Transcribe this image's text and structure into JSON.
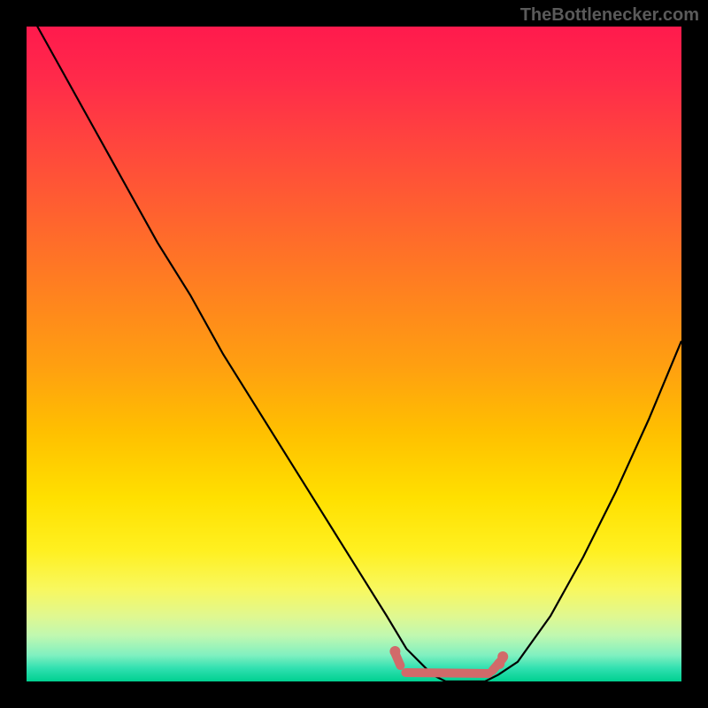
{
  "attribution": "TheBottlenecker.com",
  "chart_data": {
    "type": "line",
    "title": "",
    "xlabel": "",
    "ylabel": "",
    "xlim": [
      0,
      100
    ],
    "ylim": [
      0,
      100
    ],
    "series": [
      {
        "name": "bottleneck-curve",
        "x": [
          0,
          5,
          10,
          15,
          20,
          25,
          30,
          35,
          40,
          45,
          50,
          55,
          58,
          60,
          62,
          64,
          66,
          68,
          70,
          72,
          75,
          80,
          85,
          90,
          95,
          100
        ],
        "values": [
          103,
          94,
          85,
          76,
          67,
          59,
          50,
          42,
          34,
          26,
          18,
          10,
          5,
          3,
          1,
          0,
          0,
          0,
          0,
          1,
          3,
          10,
          19,
          29,
          40,
          52
        ]
      }
    ],
    "highlight": {
      "name": "optimal-range",
      "x_range": [
        56,
        73
      ],
      "y": 0
    },
    "background_gradient": {
      "stops": [
        {
          "pos": 0.0,
          "color": "#ff1a4d"
        },
        {
          "pos": 0.5,
          "color": "#ffb000"
        },
        {
          "pos": 0.8,
          "color": "#fff020"
        },
        {
          "pos": 1.0,
          "color": "#00d090"
        }
      ]
    }
  }
}
